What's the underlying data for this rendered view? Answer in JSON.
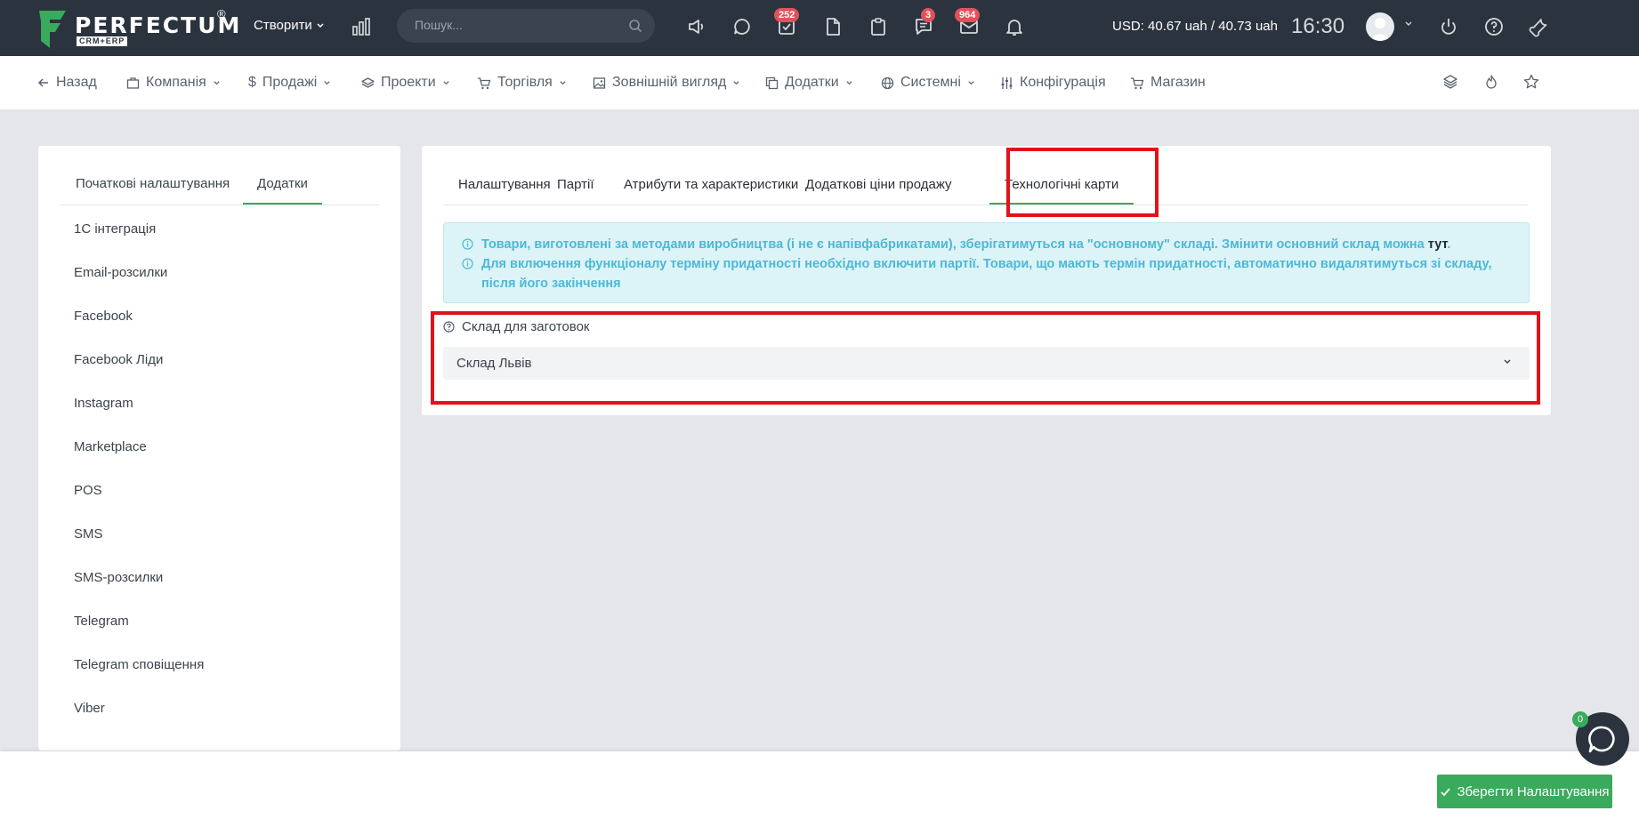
{
  "topbar": {
    "logo_text": "PERFECTUM",
    "logo_registered": "®",
    "logo_sub": "CRM+ERP",
    "create_label": "Створити",
    "search_placeholder": "Пошук...",
    "badges": {
      "tasks": "252",
      "messages": "3",
      "mail": "964"
    },
    "currency_text": "USD: 40.67 uah / 40.73 uah",
    "time": "16:30"
  },
  "nav": {
    "items": [
      {
        "label": "Назад",
        "icon": "arrow-left-icon"
      },
      {
        "label": "Компанія",
        "icon": "briefcase-icon"
      },
      {
        "label": "Продажі",
        "icon": "dollar-icon"
      },
      {
        "label": "Проекти",
        "icon": "layers-icon"
      },
      {
        "label": "Торгівля",
        "icon": "cart-icon"
      },
      {
        "label": "Зовнішній вигляд",
        "icon": "image-icon"
      },
      {
        "label": "Додатки",
        "icon": "copy-icon"
      },
      {
        "label": "Системні",
        "icon": "globe-icon"
      },
      {
        "label": "Конфігурація",
        "icon": "sliders-icon"
      },
      {
        "label": "Магазин",
        "icon": "cart-icon"
      }
    ]
  },
  "left_panel": {
    "tabs": [
      "Початкові налаштування",
      "Додатки"
    ],
    "active_tab": "Додатки",
    "items": [
      "1C інтеграція",
      "Email-розсилки",
      "Facebook",
      "Facebook Ліди",
      "Instagram",
      "Marketplace",
      "POS",
      "SMS",
      "SMS-розсилки",
      "Telegram",
      "Telegram сповіщення",
      "Viber"
    ]
  },
  "main_panel": {
    "tabs": [
      "Налаштування",
      "Партії",
      "Атрибути та характеристики",
      "Додаткові ціни продажу",
      "Технологічні карти"
    ],
    "active_tab": "Технологічні карти",
    "alert": {
      "line1": "Товари, виготовлені за методами виробництва (і не є напівфабрикатами), зберігатимуться на \"основному\" складі. Змінити основний склад можна ",
      "line1_link": "тут",
      "line1_end": ".",
      "line2": "Для включення функціоналу терміну придатності необхідно включити партії. Товари, що мають термін придатності, автоматично видалятимуться зі складу, після його закінчення"
    },
    "field_label": "Склад для заготовок",
    "field_value": "Склад Львів"
  },
  "footer": {
    "save_label": "Зберегти Налаштування",
    "chat_badge": "0"
  },
  "colors": {
    "topbar": "#2b333e",
    "accent_green": "#3aaa5c",
    "highlight_red": "#e0121b",
    "alert_text": "#4cb8d6",
    "badge_red": "#e2515a"
  }
}
